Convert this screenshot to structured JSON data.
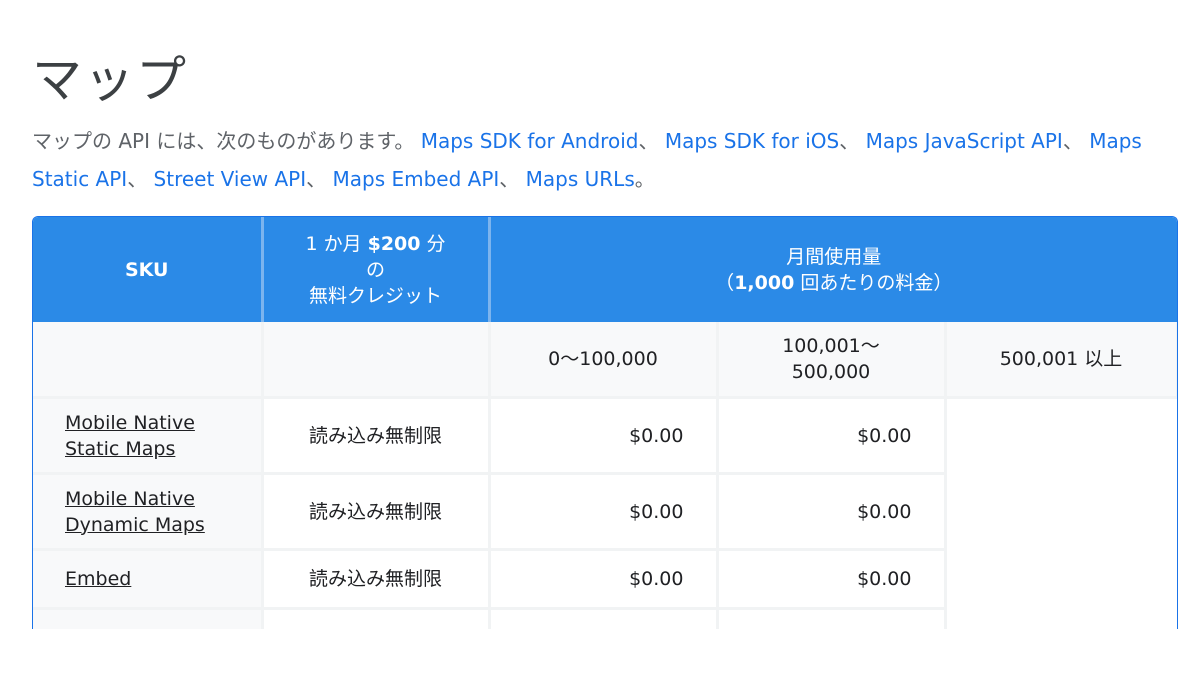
{
  "page": {
    "title": "マップ",
    "intro_text": "マップの API には、次のものがあります。",
    "links": [
      "Maps SDK for Android",
      "Maps SDK for iOS",
      "Maps JavaScript API",
      "Maps Static API",
      "Street View API",
      "Maps Embed API",
      "Maps URLs"
    ],
    "separator": "、",
    "end": "。"
  },
  "table": {
    "headers": {
      "sku": "SKU",
      "credit_line1_pre": "1 か月 ",
      "credit_line1_bold": "$200",
      "credit_line1_post": " 分",
      "credit_line2": "の",
      "credit_line3": "無料クレジット",
      "usage_line1": "月間使用量",
      "usage_open": "（",
      "usage_bold": "1,000",
      "usage_rest": " 回あたりの料金）"
    },
    "tiers": {
      "t1": "0〜100,000",
      "t2_line1": "100,001〜",
      "t2_line2": "500,000",
      "t3": "500,001 以上"
    },
    "rows": [
      {
        "sku_line1": "Mobile Native",
        "sku_line2": "Static Maps",
        "credit": "読み込み無制限",
        "price1": "$0.00",
        "price2": "$0.00"
      },
      {
        "sku_line1": "Mobile Native",
        "sku_line2": "Dynamic Maps",
        "credit": "読み込み無制限",
        "price1": "$0.00",
        "price2": "$0.00"
      },
      {
        "sku_line1": "Embed",
        "sku_line2": "",
        "credit": "読み込み無制限",
        "price1": "$0.00",
        "price2": "$0.00"
      }
    ]
  },
  "colors": {
    "accent": "#2b8ae7",
    "link": "#1a73e8"
  }
}
